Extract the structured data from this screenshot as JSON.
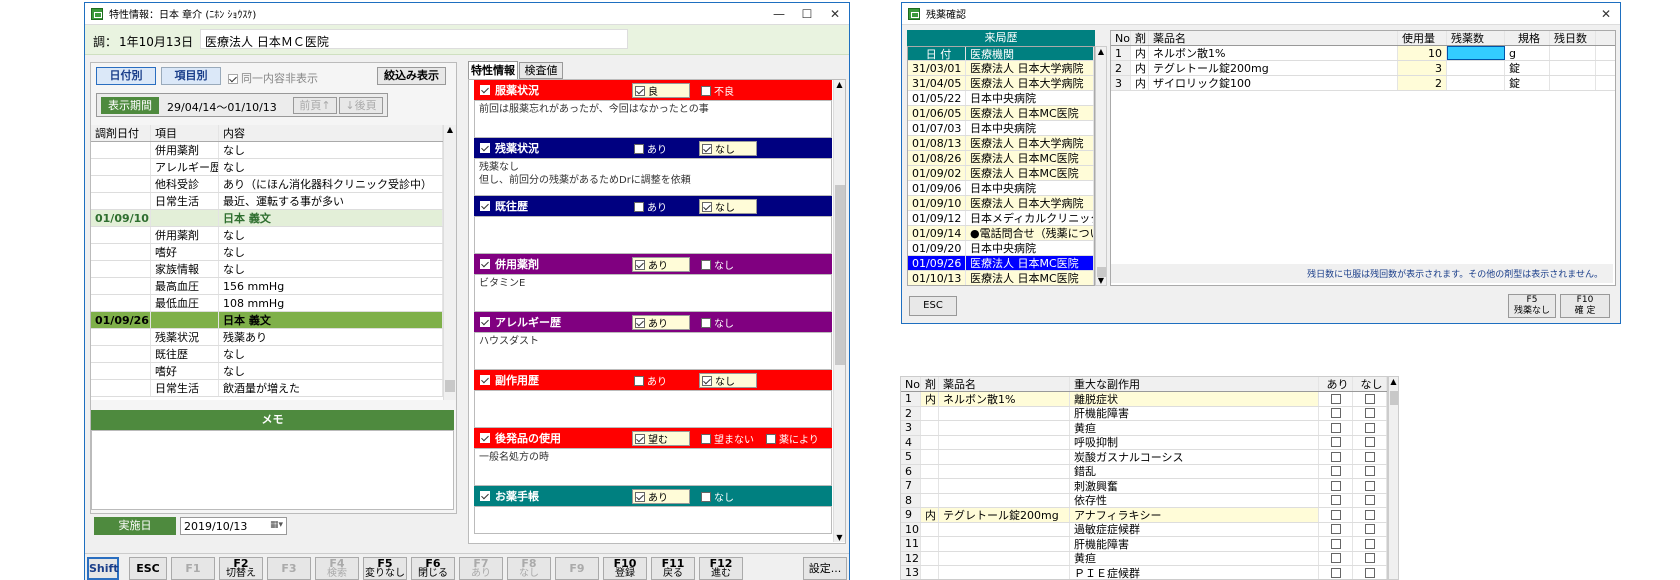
{
  "win1": {
    "title": "特性情報：日本 章介 (ﾆﾎﾝ ｼｮｳｽｹ)",
    "visit_label": "調：",
    "visit_date": "1年10月13日",
    "clinic": "医療法人 日本ＭＣ医院",
    "tab_by_date": "日付別",
    "tab_by_item": "項目別",
    "hide_same_label": "同一内容非表示",
    "filter_button": "絞込み表示",
    "period_label": "表示期間",
    "period_value": "29/04/14～01/10/13",
    "prev_button": "前頁↑",
    "next_button": "↓後頁",
    "columns": [
      "調剤日付",
      "項目",
      "内容"
    ],
    "rows": [
      {
        "date": "",
        "item": "併用薬剤",
        "content": "なし",
        "type": "normal"
      },
      {
        "date": "",
        "item": "アレルギー歴",
        "content": "なし",
        "type": "normal"
      },
      {
        "date": "",
        "item": "他科受診",
        "content": "あり（にほん消化器科クリニック受診中）",
        "type": "normal"
      },
      {
        "date": "",
        "item": "日常生活",
        "content": "最近、運転する事が多い",
        "type": "normal"
      },
      {
        "date": "01/09/10",
        "item": "",
        "content": "日本 義文",
        "type": "group1"
      },
      {
        "date": "",
        "item": "併用薬剤",
        "content": "なし",
        "type": "normal"
      },
      {
        "date": "",
        "item": "嗜好",
        "content": "なし",
        "type": "normal"
      },
      {
        "date": "",
        "item": "家族情報",
        "content": "なし",
        "type": "normal"
      },
      {
        "date": "",
        "item": "最高血圧",
        "content": "156 mmHg",
        "type": "normal"
      },
      {
        "date": "",
        "item": "最低血圧",
        "content": "108 mmHg",
        "type": "normal"
      },
      {
        "date": "01/09/26",
        "item": "",
        "content": "日本 義文",
        "type": "group2"
      },
      {
        "date": "",
        "item": "残薬状況",
        "content": "残薬あり",
        "type": "normal"
      },
      {
        "date": "",
        "item": "既往歴",
        "content": "なし",
        "type": "normal"
      },
      {
        "date": "",
        "item": "嗜好",
        "content": "なし",
        "type": "normal"
      },
      {
        "date": "",
        "item": "日常生活",
        "content": "飲酒量が増えた",
        "type": "normal"
      }
    ],
    "memo_label": "メモ",
    "impl_label": "実施日",
    "impl_date": "2019/10/13",
    "tab_info": "特性情報",
    "tab_lab": "検査値",
    "sections": [
      {
        "title": "服薬状況",
        "color": "#ff0000",
        "opt1": "良",
        "opt1_on": true,
        "opt2": "不良",
        "opt2_on": false,
        "opt3": "",
        "text": "前回は服薬忘れがあったが、今回はなかったとの事"
      },
      {
        "title": "残薬状況",
        "color": "#000080",
        "opt1": "あり",
        "opt1_on": false,
        "opt2": "なし",
        "opt2_on": true,
        "opt3": "",
        "text": "残薬なし\n但し、前回分の残薬があるためDrに調整を依頼"
      },
      {
        "title": "既往歴",
        "color": "#000080",
        "opt1": "あり",
        "opt1_on": false,
        "opt2": "なし",
        "opt2_on": true,
        "opt3": "",
        "text": ""
      },
      {
        "title": "併用薬剤",
        "color": "#800080",
        "opt1": "あり",
        "opt1_on": true,
        "opt2": "なし",
        "opt2_on": false,
        "opt3": "",
        "text": "ビタミンE"
      },
      {
        "title": "アレルギー歴",
        "color": "#800080",
        "opt1": "あり",
        "opt1_on": true,
        "opt2": "なし",
        "opt2_on": false,
        "opt3": "",
        "text": "ハウスダスト"
      },
      {
        "title": "副作用歴",
        "color": "#ff0000",
        "opt1": "あり",
        "opt1_on": false,
        "opt2": "なし",
        "opt2_on": true,
        "opt3": "",
        "text": ""
      },
      {
        "title": "後発品の使用",
        "color": "#ff0000",
        "opt1": "望む",
        "opt1_on": true,
        "opt2": "望まない",
        "opt2_on": false,
        "opt3": "薬により",
        "text": "一般名処方の時"
      },
      {
        "title": "お薬手帳",
        "color": "#008080",
        "opt1": "あり",
        "opt1_on": true,
        "opt2": "なし",
        "opt2_on": false,
        "opt3": "",
        "text": ""
      }
    ],
    "fkeys": [
      {
        "k": "Shift",
        "l": "",
        "dis": false
      },
      {
        "k": "ESC",
        "l": "",
        "dis": false
      },
      {
        "k": "F1",
        "l": "",
        "dis": true
      },
      {
        "k": "F2",
        "l": "切替え",
        "dis": false
      },
      {
        "k": "F3",
        "l": "",
        "dis": true
      },
      {
        "k": "F4",
        "l": "検索",
        "dis": true
      },
      {
        "k": "F5",
        "l": "変りなし",
        "dis": false
      },
      {
        "k": "F6",
        "l": "閉じる",
        "dis": false
      },
      {
        "k": "F7",
        "l": "あり",
        "dis": true
      },
      {
        "k": "F8",
        "l": "なし",
        "dis": true
      },
      {
        "k": "F9",
        "l": "",
        "dis": true
      },
      {
        "k": "F10",
        "l": "登録",
        "dis": false
      },
      {
        "k": "F11",
        "l": "戻る",
        "dis": false
      },
      {
        "k": "F12",
        "l": "進む",
        "dis": false
      }
    ],
    "settings_button": "設定..."
  },
  "win2": {
    "title": "残薬確認",
    "history_header": "来局歴",
    "history_cols": [
      "日 付",
      "医療機関"
    ],
    "history": [
      {
        "d": "31/03/01",
        "c": "医療法人 日本大学病院",
        "hl": true
      },
      {
        "d": "31/04/05",
        "c": "医療法人 日本大学病院",
        "hl": true
      },
      {
        "d": "01/05/22",
        "c": "日本中央病院",
        "hl": false
      },
      {
        "d": "01/06/05",
        "c": "医療法人 日本MC医院",
        "hl": true
      },
      {
        "d": "01/07/03",
        "c": "日本中央病院",
        "hl": false
      },
      {
        "d": "01/08/13",
        "c": "医療法人 日本大学病院",
        "hl": true
      },
      {
        "d": "01/08/26",
        "c": "医療法人 日本MC医院",
        "hl": true
      },
      {
        "d": "01/09/02",
        "c": "医療法人 日本MC医院",
        "hl": true
      },
      {
        "d": "01/09/06",
        "c": "日本中央病院",
        "hl": false
      },
      {
        "d": "01/09/10",
        "c": "医療法人 日本大学病院",
        "hl": true
      },
      {
        "d": "01/09/12",
        "c": "日本メディカルクリニック",
        "hl": false
      },
      {
        "d": "01/09/14",
        "c": "●電話問合せ（残薬について",
        "hl": true
      },
      {
        "d": "01/09/20",
        "c": "日本中央病院",
        "hl": false
      },
      {
        "d": "01/09/26",
        "c": "医療法人 日本MC医院",
        "hl": "sel"
      },
      {
        "d": "01/10/13",
        "c": "医療法人 日本MC医院",
        "hl": true
      }
    ],
    "drug_cols": [
      "No.",
      "剤",
      "薬品名",
      "使用量",
      "残薬数",
      "規格",
      "残日数"
    ],
    "drugs": [
      {
        "no": "1",
        "kind": "内",
        "name": "ネルボン散1%",
        "qty": "10",
        "rem": "",
        "unit": "g",
        "days": ""
      },
      {
        "no": "2",
        "kind": "内",
        "name": "テグレトール錠200mg",
        "qty": "3",
        "rem": "",
        "unit": "錠",
        "days": ""
      },
      {
        "no": "3",
        "kind": "内",
        "name": "ザイロリック錠100",
        "qty": "2",
        "rem": "",
        "unit": "錠",
        "days": ""
      }
    ],
    "note": "残日数に屯服は残回数が表示されます。その他の剤型は表示されません。",
    "esc": "ESC",
    "f5_key": "F5",
    "f5_label": "残薬なし",
    "f10_key": "F10",
    "f10_label": "確 定"
  },
  "win3": {
    "cols": [
      "No.",
      "剤",
      "薬品名",
      "重大な副作用",
      "あり",
      "なし"
    ],
    "rows": [
      {
        "no": "1",
        "kind": "内",
        "name": "ネルボン散1%",
        "effect": "離脱症状",
        "hl": true
      },
      {
        "no": "2",
        "kind": "",
        "name": "",
        "effect": "肝機能障害",
        "hl": false
      },
      {
        "no": "3",
        "kind": "",
        "name": "",
        "effect": "黄疸",
        "hl": false
      },
      {
        "no": "4",
        "kind": "",
        "name": "",
        "effect": "呼吸抑制",
        "hl": false
      },
      {
        "no": "5",
        "kind": "",
        "name": "",
        "effect": "炭酸ガスナルコーシス",
        "hl": false
      },
      {
        "no": "6",
        "kind": "",
        "name": "",
        "effect": "錯乱",
        "hl": false
      },
      {
        "no": "7",
        "kind": "",
        "name": "",
        "effect": "刺激興奮",
        "hl": false
      },
      {
        "no": "8",
        "kind": "",
        "name": "",
        "effect": "依存性",
        "hl": false
      },
      {
        "no": "9",
        "kind": "内",
        "name": "テグレトール錠200mg",
        "effect": "アナフィラキシー",
        "hl": true
      },
      {
        "no": "10",
        "kind": "",
        "name": "",
        "effect": "過敏症症候群",
        "hl": false
      },
      {
        "no": "11",
        "kind": "",
        "name": "",
        "effect": "肝機能障害",
        "hl": false
      },
      {
        "no": "12",
        "kind": "",
        "name": "",
        "effect": "黄疸",
        "hl": false
      },
      {
        "no": "13",
        "kind": "",
        "name": "",
        "effect": "ＰＩＥ症候群",
        "hl": false
      }
    ]
  }
}
